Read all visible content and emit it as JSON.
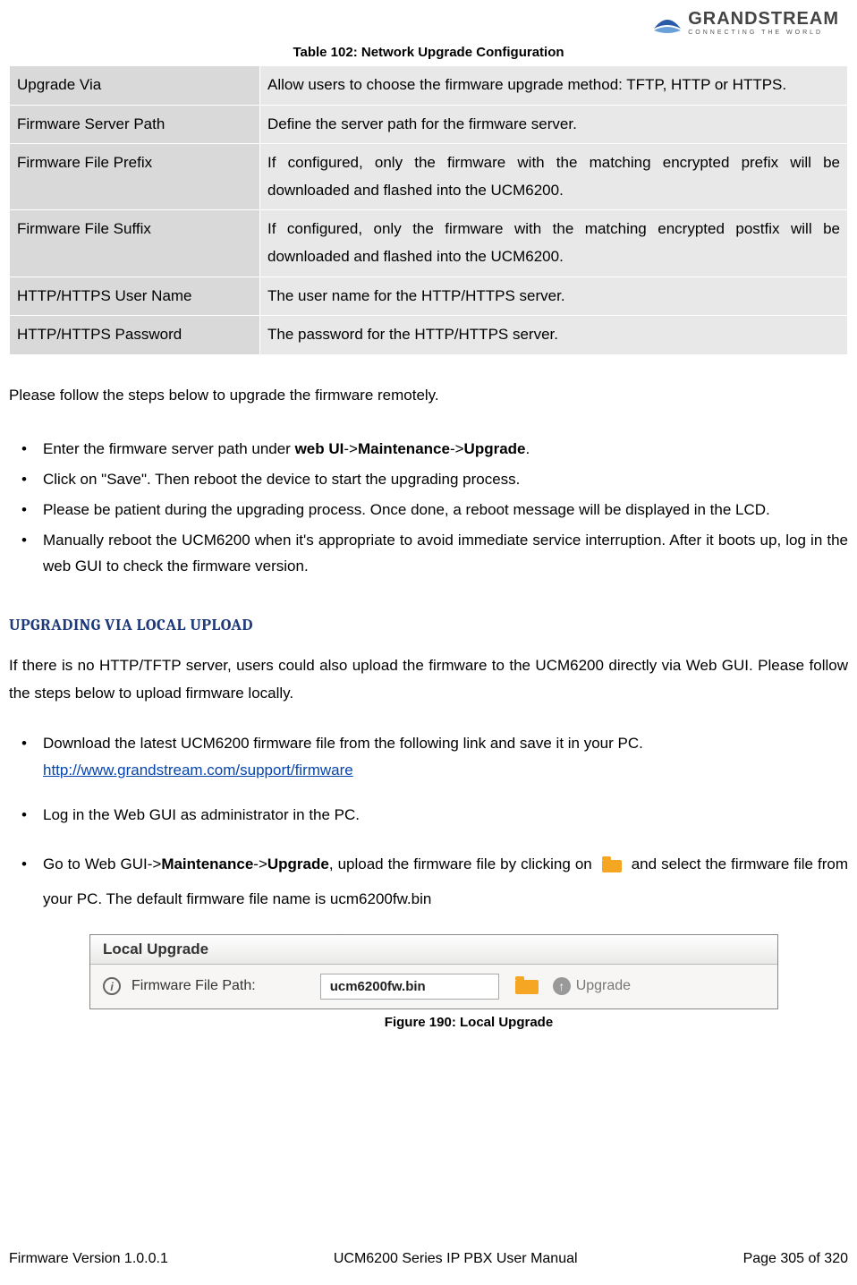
{
  "logo": {
    "name": "GRANDSTREAM",
    "tagline": "CONNECTING THE WORLD"
  },
  "table_caption": "Table 102: Network Upgrade Configuration",
  "table_rows": [
    {
      "label": "Upgrade Via",
      "desc": "Allow users to choose the firmware upgrade method: TFTP, HTTP or HTTPS."
    },
    {
      "label": "Firmware Server Path",
      "desc": "Define the server path for the firmware server."
    },
    {
      "label": "Firmware File Prefix",
      "desc": "If configured, only the firmware with the matching encrypted prefix will be downloaded and flashed into the UCM6200."
    },
    {
      "label": "Firmware File Suffix",
      "desc": "If configured, only the firmware with the matching encrypted postfix will be downloaded and flashed into the UCM6200."
    },
    {
      "label": "HTTP/HTTPS User Name",
      "desc": "The user name for the HTTP/HTTPS server."
    },
    {
      "label": "HTTP/HTTPS Password",
      "desc": "The password for the HTTP/HTTPS server."
    }
  ],
  "intro": "Please follow the steps below to upgrade the firmware remotely.",
  "steps1": {
    "s1_pre": "Enter the firmware server path under ",
    "s1_b1": "web UI",
    "s1_sep": "->",
    "s1_b2": "Maintenance",
    "s1_b3": "Upgrade",
    "s1_post": ".",
    "s2": "Click on \"Save\". Then reboot the device to start the upgrading process.",
    "s3": "Please be patient during the upgrading process. Once done, a reboot message will be displayed in the LCD.",
    "s4": "Manually reboot the UCM6200 when it's appropriate to avoid immediate service interruption. After it boots up, log in the web GUI to check the firmware version."
  },
  "section2_title": "UPGRADING VIA LOCAL UPLOAD",
  "section2_intro": "If there is no HTTP/TFTP server, users could also upload the firmware to the UCM6200 directly via Web GUI. Please follow the steps below to upload firmware locally.",
  "steps2": {
    "s1": "Download the latest UCM6200 firmware file from the following link and save it in your PC.",
    "s1_link": "http://www.grandstream.com/support/firmware",
    "s2": "Log in the Web GUI as administrator in the PC.",
    "s3_pre": "Go to Web GUI->",
    "s3_b1": "Maintenance",
    "s3_sep": "->",
    "s3_b2": "Upgrade",
    "s3_mid": ", upload the firmware file by clicking on ",
    "s3_post": " and select the firmware file from your PC. The default firmware file name is ucm6200fw.bin"
  },
  "figure": {
    "header": "Local Upgrade",
    "label": "Firmware File Path:",
    "input_value": "ucm6200fw.bin",
    "button": "Upgrade",
    "caption": "Figure 190: Local Upgrade"
  },
  "footer": {
    "left": "Firmware Version 1.0.0.1",
    "mid": "UCM6200 Series IP PBX User Manual",
    "right": "Page 305 of 320"
  }
}
